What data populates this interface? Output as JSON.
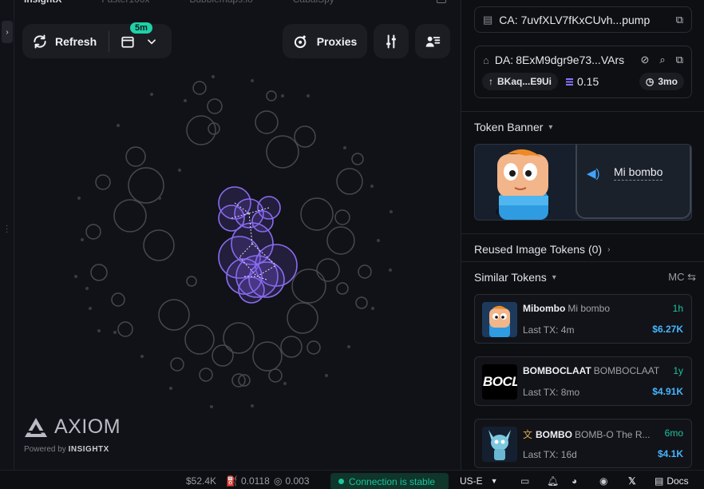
{
  "top_tabs": [
    "InsightX",
    "Faster100x",
    "Bubblemaps.io",
    "CabalSpy"
  ],
  "toolbar": {
    "refresh_label": "Refresh",
    "interval_badge": "5m",
    "proxies_label": "Proxies"
  },
  "brand": {
    "name": "AXIOM",
    "powered_prefix": "Powered by",
    "powered_brand": "INSIGHTX"
  },
  "sidebar": {
    "ca": {
      "prefix": "CA:",
      "value": "7uvfXLV7fKxCUvh...pump"
    },
    "da": {
      "prefix": "DA:",
      "value": "8ExM9dgr9e73...VArs"
    },
    "dev_wallet": "BKaq...E9Ui",
    "sol_balance": "0.15",
    "age": "3mo",
    "token_banner_label": "Token Banner",
    "banner_text": "Mi bombo",
    "reused_label": "Reused Image Tokens (0)",
    "similar_label": "Similar Tokens",
    "mc_toggle": "MC",
    "similar_tokens": [
      {
        "symbol": "Mibombo",
        "name": "Mi bombo",
        "age": "1h",
        "last_tx": "Last TX: 4m",
        "mc": "$6.27K"
      },
      {
        "symbol": "BOMBOCLAAT",
        "name": "BOMBOCLAAT",
        "age": "1y",
        "last_tx": "Last TX: 8mo",
        "mc": "$4.91K",
        "img_text": "BOCL"
      },
      {
        "symbol": "BOMBO",
        "name": "BOMB-O The R...",
        "age": "6mo",
        "last_tx": "Last TX: 16d",
        "mc": "$4.1K"
      }
    ]
  },
  "footer": {
    "market_cap": "$52.4K",
    "fee": "0.0118",
    "sol": "0.003",
    "connection": "Connection is stable",
    "region": "US-E",
    "docs_label": "Docs"
  },
  "colors": {
    "accent_purple": "#8a6cf0",
    "accent_green": "#19c59e",
    "accent_blue": "#45b6ff",
    "panel_bg": "#111217"
  }
}
